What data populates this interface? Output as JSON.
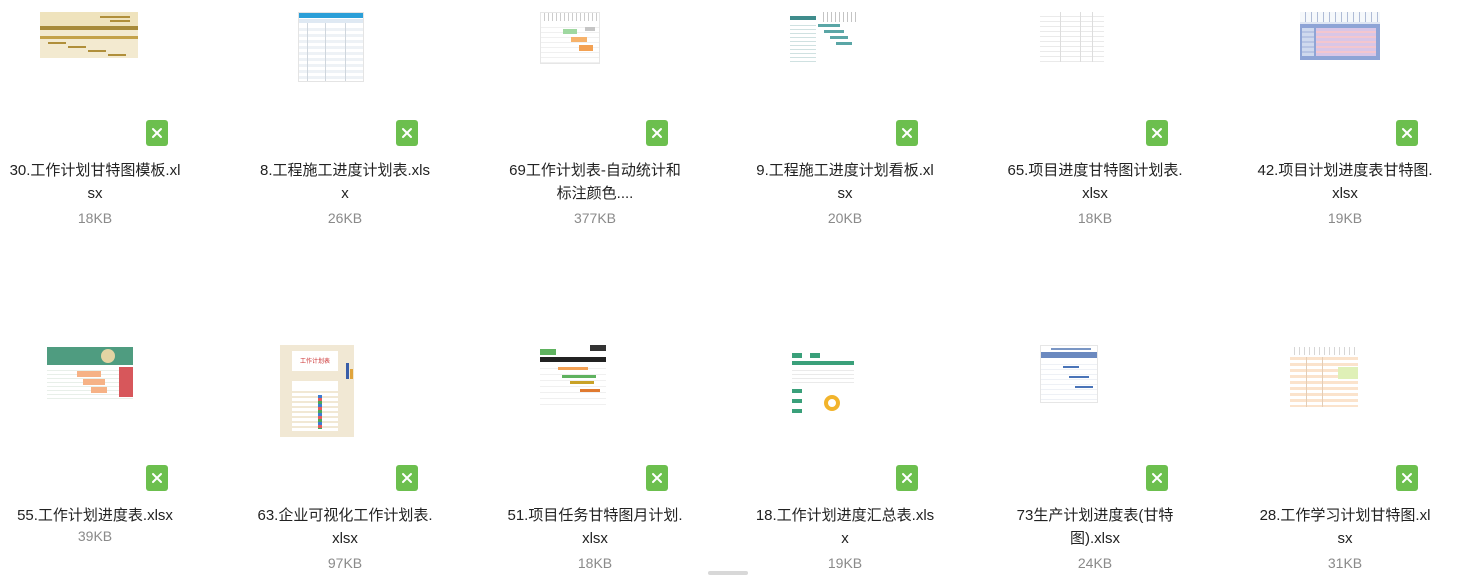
{
  "files": [
    {
      "line1": "30.工作计划甘特图模板.xl",
      "line2": "sx",
      "size": "18KB"
    },
    {
      "line1": "8.工程施工进度计划表.xls",
      "line2": "x",
      "size": "26KB"
    },
    {
      "line1": "69工作计划表-自动统计和",
      "line2": "标注颜色....",
      "size": "377KB"
    },
    {
      "line1": "9.工程施工进度计划看板.xl",
      "line2": "sx",
      "size": "20KB"
    },
    {
      "line1": "65.项目进度甘特图计划表.",
      "line2": "xlsx",
      "size": "18KB"
    },
    {
      "line1": "42.项目计划进度表甘特图.",
      "line2": "xlsx",
      "size": "19KB"
    },
    {
      "line1": "55.工作计划进度表.xlsx",
      "line2": "",
      "size": "39KB"
    },
    {
      "line1": "63.企业可视化工作计划表.",
      "line2": "xlsx",
      "size": "97KB"
    },
    {
      "line1": "51.项目任务甘特图月计划.",
      "line2": "xlsx",
      "size": "18KB"
    },
    {
      "line1": "18.工作计划进度汇总表.xls",
      "line2": "x",
      "size": "19KB"
    },
    {
      "line1": "73生产计划进度表(甘特",
      "line2": "图).xlsx",
      "size": "24KB"
    },
    {
      "line1": "28.工作学习计划甘特图.xl",
      "line2": "sx",
      "size": "31KB"
    }
  ],
  "thumb_text": {
    "work_plan_title": "工作计划表"
  },
  "icons": {
    "file_type": "excel-file-icon"
  },
  "colors": {
    "excel_green": "#6cbf4e"
  }
}
